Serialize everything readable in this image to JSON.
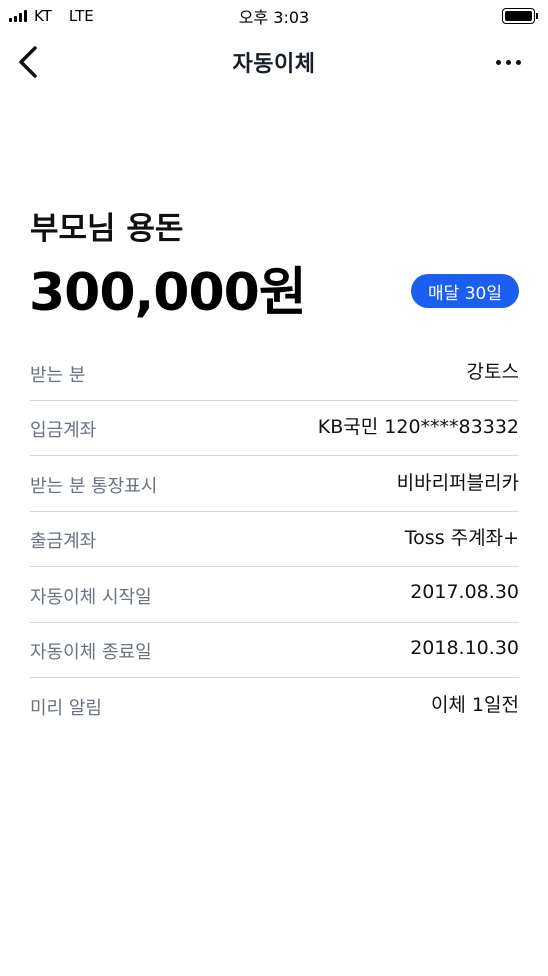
{
  "status_bar": {
    "carrier": "KT",
    "network": "LTE",
    "time": "오후 3:03"
  },
  "nav": {
    "title": "자동이체"
  },
  "summary": {
    "name": "부모님 용돈",
    "amount": "300,000원",
    "schedule": "매달 30일"
  },
  "details": [
    {
      "label": "받는 분",
      "value": "강토스"
    },
    {
      "label": "입금계좌",
      "value": "KB국민 120****83332"
    },
    {
      "label": "받는 분 통장표시",
      "value": "비바리퍼블리카"
    },
    {
      "label": "출금계좌",
      "value": "Toss 주계좌+"
    },
    {
      "label": "자동이체 시작일",
      "value": "2017.08.30"
    },
    {
      "label": "자동이체 종료일",
      "value": "2018.10.30"
    },
    {
      "label": "미리 알림",
      "value": "이체 1일전"
    }
  ],
  "colors": {
    "accent": "#1b5ff0",
    "label_text": "#6a7280",
    "divider": "#d5d8e2"
  },
  "icons": {
    "back": "chevron-left-icon",
    "more": "more-horizontal-icon",
    "signal": "signal-icon",
    "battery": "battery-icon"
  }
}
